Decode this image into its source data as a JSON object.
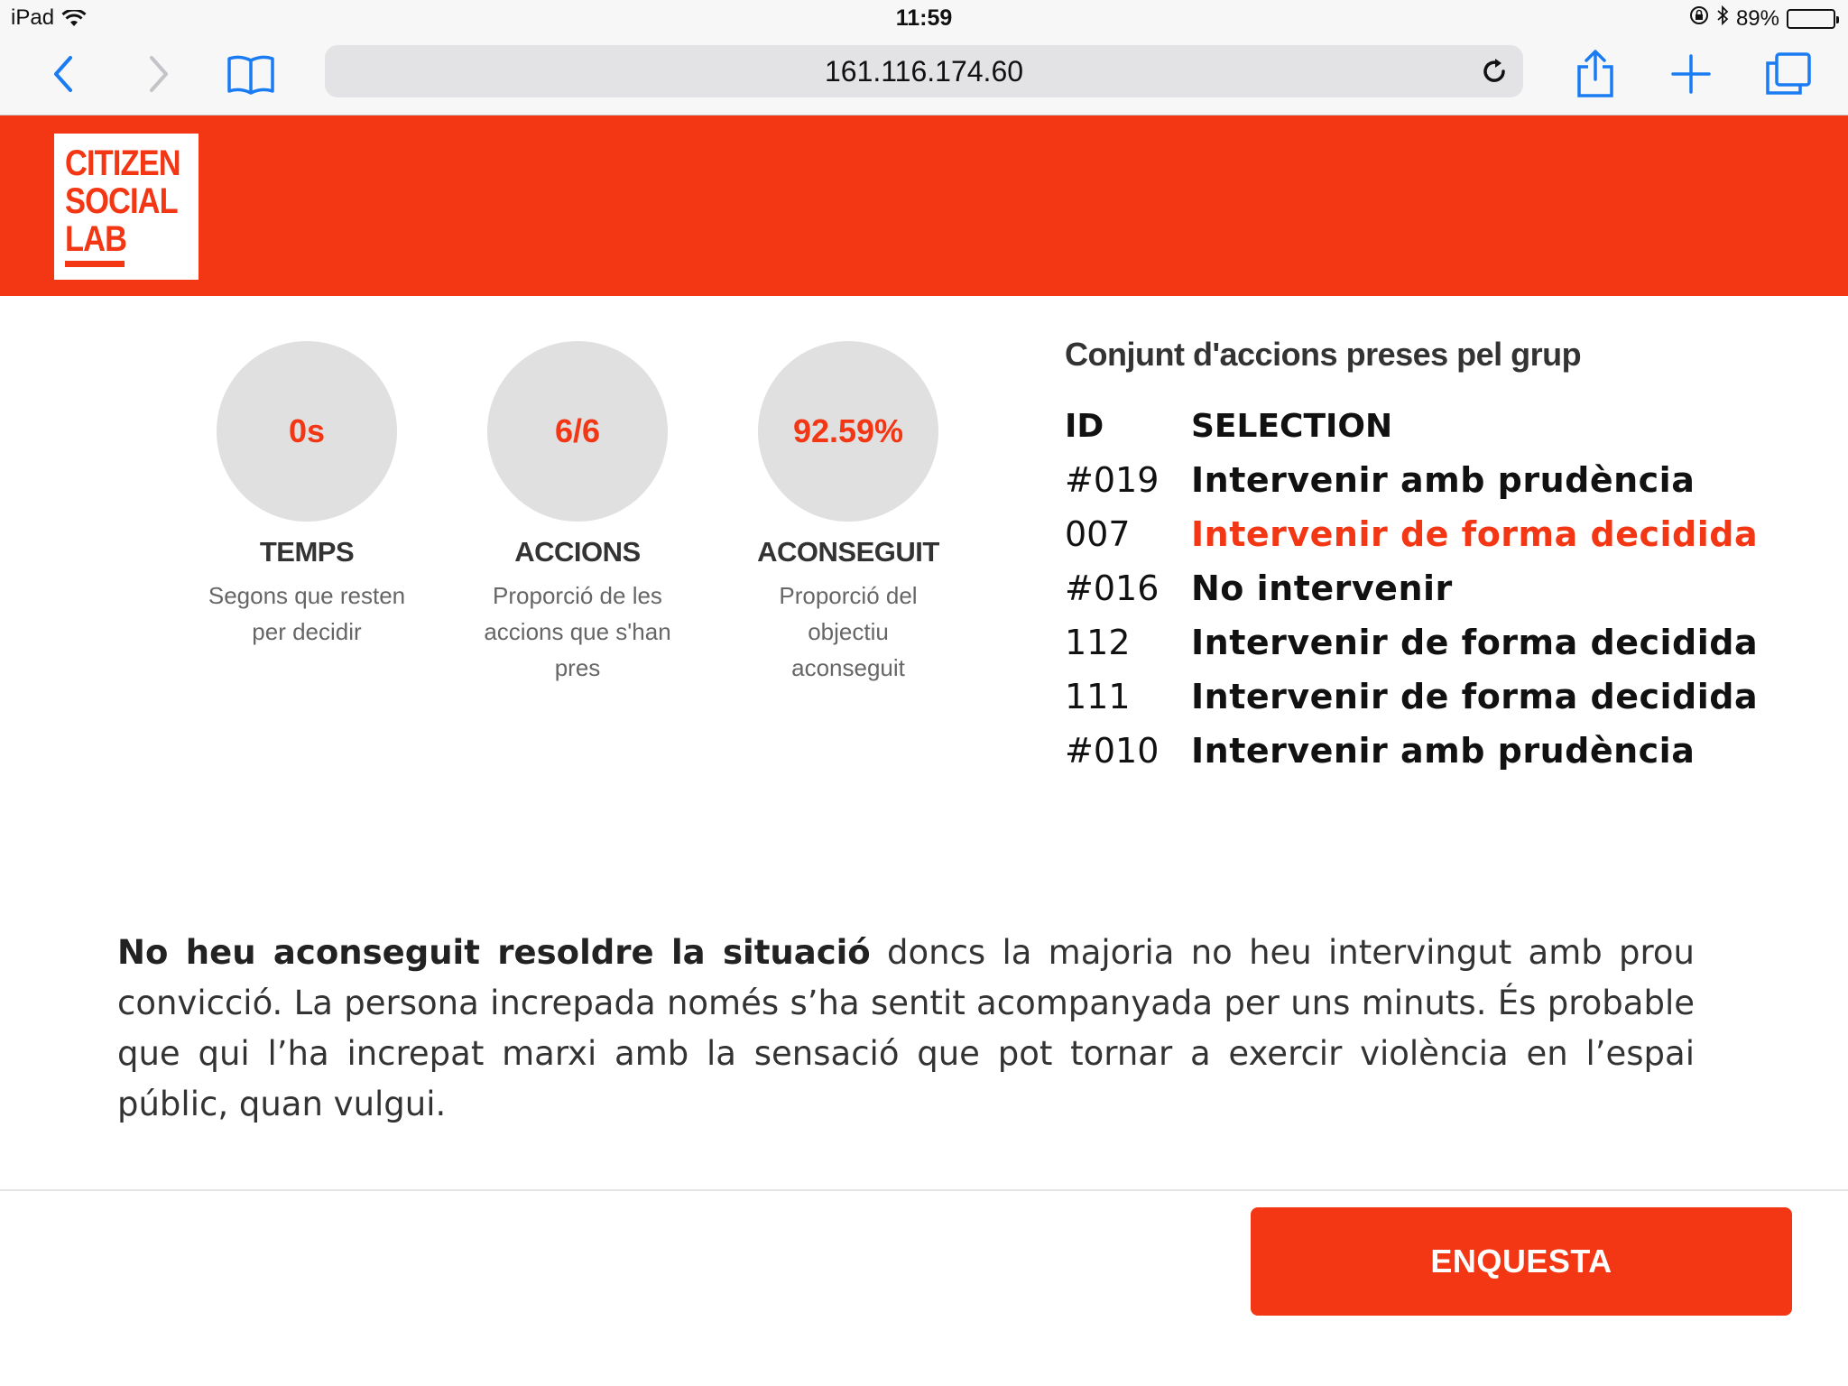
{
  "status_bar": {
    "device": "iPad",
    "time": "11:59",
    "battery": "89%",
    "battery_level": 0.89
  },
  "browser": {
    "url": "161.116.174.60",
    "icons": [
      "back-icon",
      "forward-icon",
      "bookmarks-icon",
      "reload-icon",
      "share-icon",
      "new-tab-icon",
      "tabs-icon"
    ]
  },
  "brand": {
    "logo_lines": [
      "CITIZEN",
      "SOCIAL",
      "LAB"
    ]
  },
  "stats": [
    {
      "value": "0s",
      "label": "TEMPS",
      "description": "Segons que resten per decidir"
    },
    {
      "value": "6/6",
      "label": "ACCIONS",
      "description": "Proporció de les accions que s'han pres"
    },
    {
      "value": "92.59%",
      "label": "ACONSEGUIT",
      "description": "Proporció del objectiu aconseguit"
    }
  ],
  "group_actions": {
    "title": "Conjunt d'accions preses pel grup",
    "headers": {
      "id": "ID",
      "selection": "SELECTION"
    },
    "rows": [
      {
        "id": "#019",
        "selection": "Intervenir amb prudència"
      },
      {
        "id": "007",
        "selection": "Intervenir de forma decidida"
      },
      {
        "id": "#016",
        "selection": "No intervenir"
      },
      {
        "id": "112",
        "selection": "Intervenir de forma decidida"
      },
      {
        "id": "111",
        "selection": "Intervenir de forma decidida"
      },
      {
        "id": "#010",
        "selection": "Intervenir amb prudència"
      }
    ]
  },
  "result": {
    "headline": "No heu aconseguit resoldre la situació",
    "body": " doncs la majoria no heu intervingut amb prou convicció. La persona increpada només s’ha sentit acompanyada per uns minuts. És probable que qui l’ha increpat marxi amb la sensació que pot tornar a exercir violència en l’espai públic, quan vulgui."
  },
  "cta": {
    "label": "ENQUESTA"
  },
  "colors": {
    "accent": "#f33614",
    "circle": "#e0e0e0",
    "ios_blue": "#1a7cf3"
  }
}
